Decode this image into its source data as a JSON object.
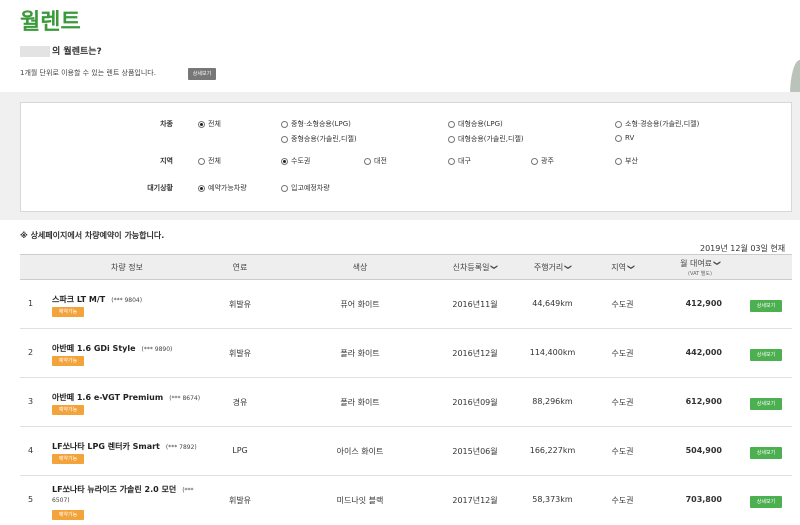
{
  "page": {
    "title": "월렌트",
    "subtitle": "의 월렌트는?",
    "description": "1개월 단위로 이용할 수 있는 렌트 상품입니다.",
    "detail_small_label": "상세보기"
  },
  "filters": {
    "car_type": {
      "label": "차종",
      "options": [
        "전체",
        "중형·소형승용(LPG)",
        "대형승용(LPG)",
        "소형·경승용(가솔린,디젤)",
        "중형승용(가솔린,디젤)",
        "대형승용(가솔린,디젤)",
        "RV"
      ],
      "selected": "전체"
    },
    "region": {
      "label": "지역",
      "options": [
        "전체",
        "수도권",
        "대전",
        "대구",
        "광주",
        "부산"
      ],
      "selected": "수도권"
    },
    "status": {
      "label": "대기상황",
      "options": [
        "예약가능차량",
        "입고예정차량"
      ],
      "selected": "예약가능차량"
    }
  },
  "notice": "※ 상세페이지에서 차량예약이 가능합니다.",
  "date": "2019년 12월 03일 현재",
  "table": {
    "headers": {
      "car": "차량 정보",
      "fuel": "연료",
      "color": "색상",
      "reg": "신차등록일",
      "mileage": "주행거리",
      "region": "지역",
      "price": "월 대여료",
      "price_sub": "(VAT 별도)"
    },
    "rows": [
      {
        "no": "1",
        "name": "스파크 LT M/T",
        "plate": "(*** 9804)",
        "plate2": "",
        "badge": "예약가능",
        "fuel": "휘발유",
        "color": "퓨어 화이트",
        "reg": "2016년11월",
        "mileage": "44,649km",
        "region": "수도권",
        "price": "412,900",
        "btn": "상세보기"
      },
      {
        "no": "2",
        "name": "아반떼 1.6 GDi Style",
        "plate": "(*** 9890)",
        "plate2": "",
        "badge": "예약가능",
        "fuel": "휘발유",
        "color": "폴라 화이트",
        "reg": "2016년12월",
        "mileage": "114,400km",
        "region": "수도권",
        "price": "442,000",
        "btn": "상세보기"
      },
      {
        "no": "3",
        "name": "아반떼 1.6 e-VGT Premium",
        "plate": "(*** 8674)",
        "plate2": "",
        "badge": "예약가능",
        "fuel": "경유",
        "color": "폴라 화이트",
        "reg": "2016년09월",
        "mileage": "88,296km",
        "region": "수도권",
        "price": "612,900",
        "btn": "상세보기"
      },
      {
        "no": "4",
        "name": "LF쏘나타 LPG 렌터카 Smart",
        "plate": "(*** 7892)",
        "plate2": "",
        "badge": "예약가능",
        "fuel": "LPG",
        "color": "아이스 화이트",
        "reg": "2015년06월",
        "mileage": "166,227km",
        "region": "수도권",
        "price": "504,900",
        "btn": "상세보기"
      },
      {
        "no": "5",
        "name": "LF쏘나타 뉴라이즈 가솔린 2.0 모던",
        "plate": "(***",
        "plate2": "6507)",
        "badge": "예약가능",
        "fuel": "휘발유",
        "color": "미드나잇 블랙",
        "reg": "2017년12월",
        "mileage": "58,373km",
        "region": "수도권",
        "price": "703,800",
        "btn": "상세보기"
      }
    ]
  }
}
